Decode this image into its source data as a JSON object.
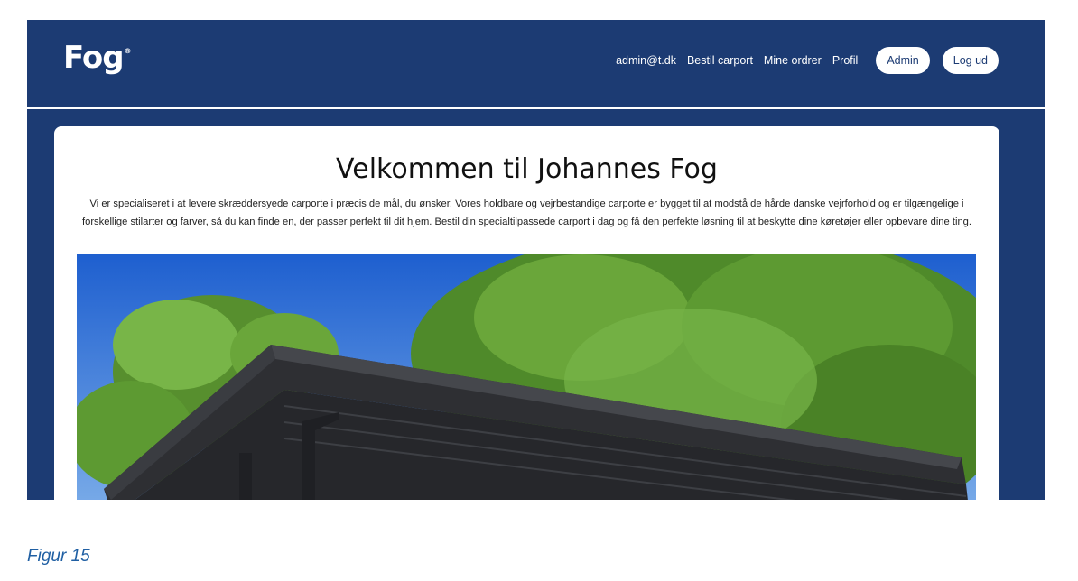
{
  "header": {
    "logo": "Fog",
    "logo_mark": "®",
    "nav": {
      "user_email": "admin@t.dk",
      "order_carport": "Bestil carport",
      "my_orders": "Mine ordrer",
      "profile": "Profil",
      "admin_button": "Admin",
      "logout_button": "Log ud"
    }
  },
  "main": {
    "title": "Velkommen til Johannes Fog",
    "intro": "Vi er specialiseret i at levere skræddersyede carporte i præcis de mål, du ønsker. Vores holdbare og vejrbestandige carporte er bygget til at modstå de hårde danske vejrforhold og er tilgængelige i forskellige stilarter og farver, så du kan finde en, der passer perfekt til dit hjem. Bestil din specialtilpassede carport i dag og få den perfekte løsning til at beskytte dine køretøjer eller opbevare dine ting."
  },
  "caption": "Figur 15",
  "colors": {
    "navy": "#1c3b73",
    "white": "#ffffff",
    "caption_blue": "#1f5fa3"
  }
}
